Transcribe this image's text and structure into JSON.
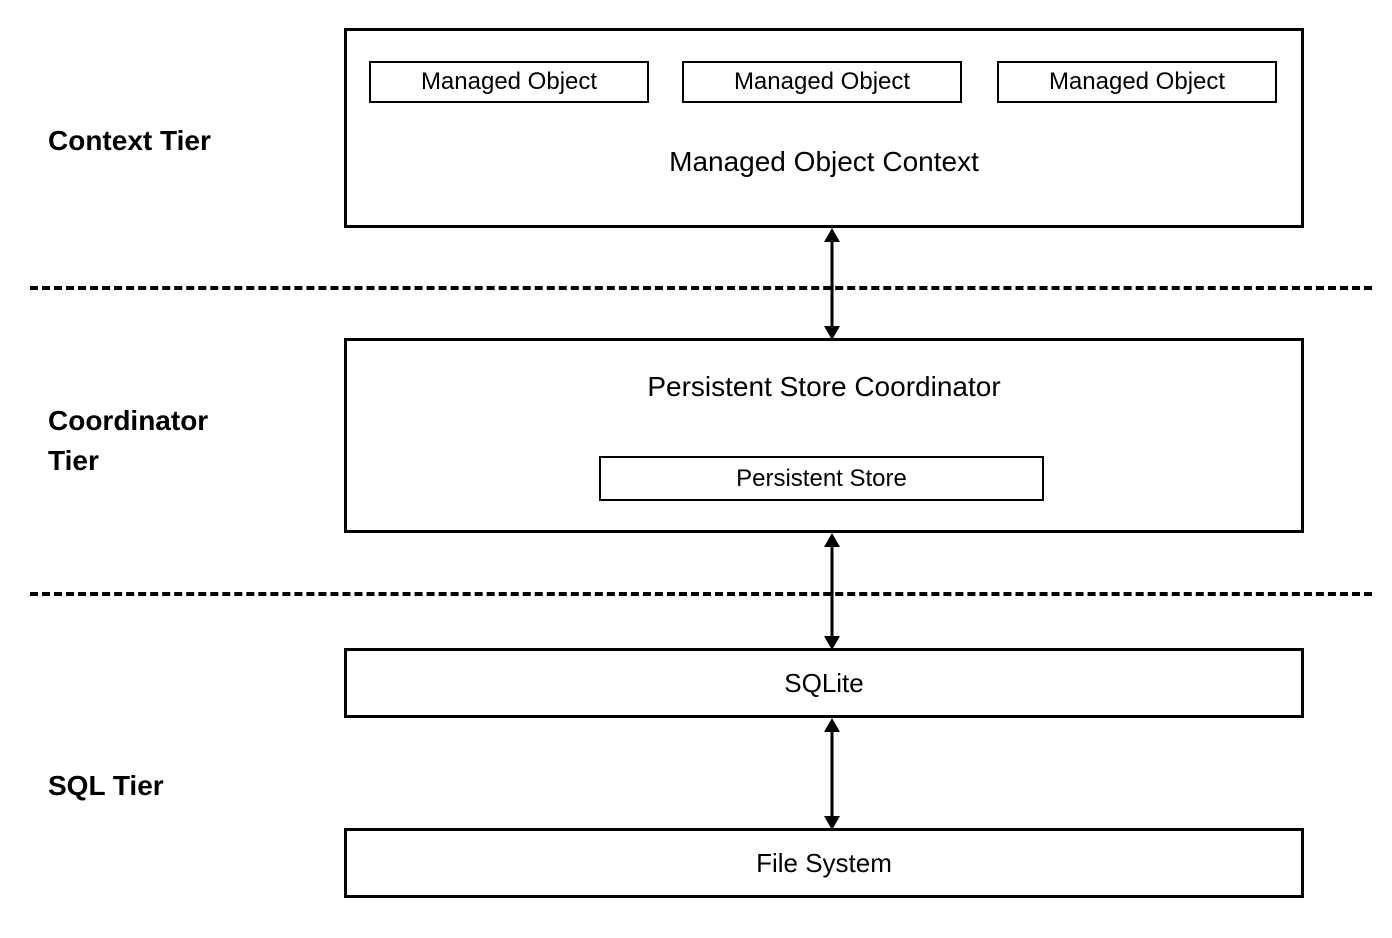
{
  "tiers": {
    "context": "Context Tier",
    "coordinator_line1": "Coordinator",
    "coordinator_line2": "Tier",
    "sql": "SQL Tier"
  },
  "boxes": {
    "managed_object_1": "Managed Object",
    "managed_object_2": "Managed Object",
    "managed_object_3": "Managed Object",
    "managed_object_context": "Managed Object Context",
    "persistent_store_coordinator": "Persistent Store Coordinator",
    "persistent_store": "Persistent Store",
    "sqlite": "SQLite",
    "file_system": "File System"
  }
}
